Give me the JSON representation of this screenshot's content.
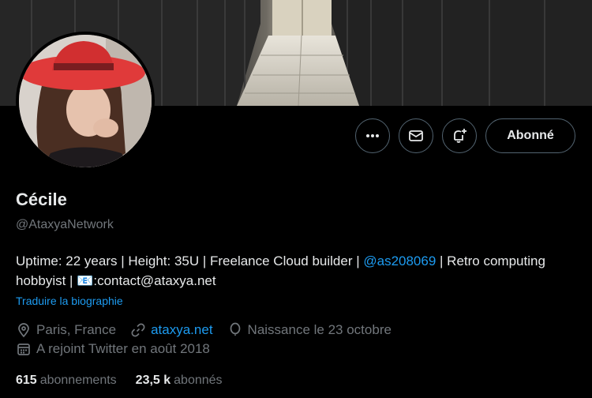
{
  "profile": {
    "name": "Cécile",
    "handle": "@AtaxyaNetwork",
    "bio_part1": "Uptime: 22 years | Height: 35U | Freelance Cloud builder | ",
    "bio_link": "@as208069",
    "bio_part2": " | Retro computing hobbyist | ",
    "bio_emoji": "📧",
    "bio_part3": ":contact@ataxya.net",
    "translate": "Traduire la biographie",
    "location": "Paris, France",
    "website": "ataxya.net",
    "birthday": "Naissance le 23 octobre",
    "joined": "A rejoint Twitter en août 2018",
    "following_count": "615",
    "following_label": "abonnements",
    "followers_count": "23,5 k",
    "followers_label": "abonnés"
  },
  "actions": {
    "follow_label": "Abonné"
  },
  "icons": {
    "more": "more-icon",
    "message": "mail-icon",
    "notify": "bell-plus-icon",
    "location": "location-pin-icon",
    "link": "link-icon",
    "birthday": "balloon-icon",
    "calendar": "calendar-icon"
  },
  "colors": {
    "background": "#000000",
    "text": "#e7e9ea",
    "secondary": "#71767b",
    "link": "#1d9bf0",
    "border": "#536471"
  }
}
